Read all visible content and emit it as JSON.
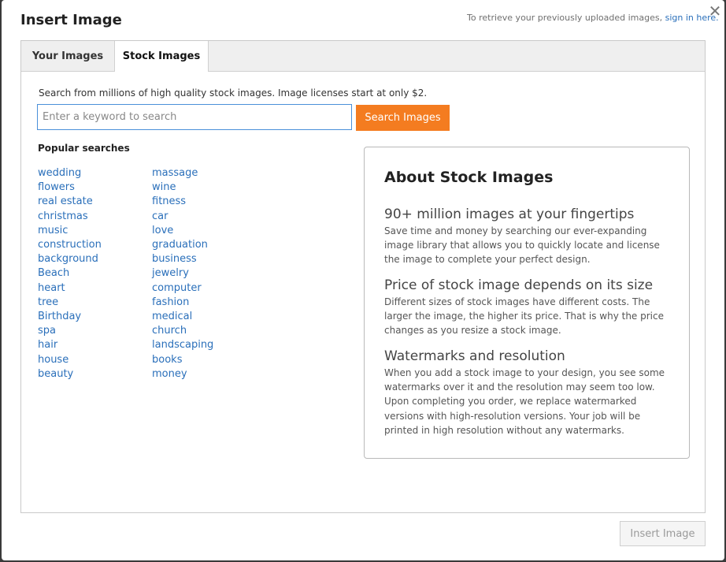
{
  "dialog": {
    "title": "Insert Image",
    "signin_prefix": "To retrieve your previously uploaded images,",
    "signin_link": "sign in here.",
    "close_glyph": "✕"
  },
  "tabs": [
    {
      "label": "Your Images",
      "active": false
    },
    {
      "label": "Stock Images",
      "active": true
    }
  ],
  "search": {
    "intro": "Search from millions of high quality stock images. Image licenses start at only $2.",
    "placeholder": "Enter a keyword to search",
    "value": "",
    "button_label": "Search Images"
  },
  "popular": {
    "heading": "Popular searches",
    "col1": [
      "wedding",
      "flowers",
      "real estate",
      "christmas",
      "music",
      "construction",
      "background",
      "Beach",
      "heart",
      "tree",
      "Birthday",
      "spa",
      "hair",
      "house",
      "beauty"
    ],
    "col2": [
      "massage",
      "wine",
      "fitness",
      "car",
      "love",
      "graduation",
      "business",
      "jewelry",
      "computer",
      "fashion",
      "medical",
      "church",
      "landscaping",
      "books",
      "money"
    ]
  },
  "about": {
    "title": "About Stock Images",
    "sections": [
      {
        "heading": "90+ million images at your fingertips",
        "body": "Save time and money by searching our ever-expanding image library that allows you to quickly locate and license the image to complete your perfect design."
      },
      {
        "heading": "Price of stock image depends on its size",
        "body": "Different sizes of stock images have different costs. The larger the image, the higher its price. That is why the price changes as you resize a stock image."
      },
      {
        "heading": "Watermarks and resolution",
        "body": "When you add a stock image to your design, you see some watermarks over it and the resolution may seem too low. Upon completing you order, we replace watermarked versions with high-resolution versions. Your job will be printed in high resolution without any watermarks."
      }
    ]
  },
  "footer": {
    "insert_label": "Insert Image",
    "insert_enabled": false
  },
  "colors": {
    "accent": "#f47c20",
    "link": "#2a6fba"
  }
}
